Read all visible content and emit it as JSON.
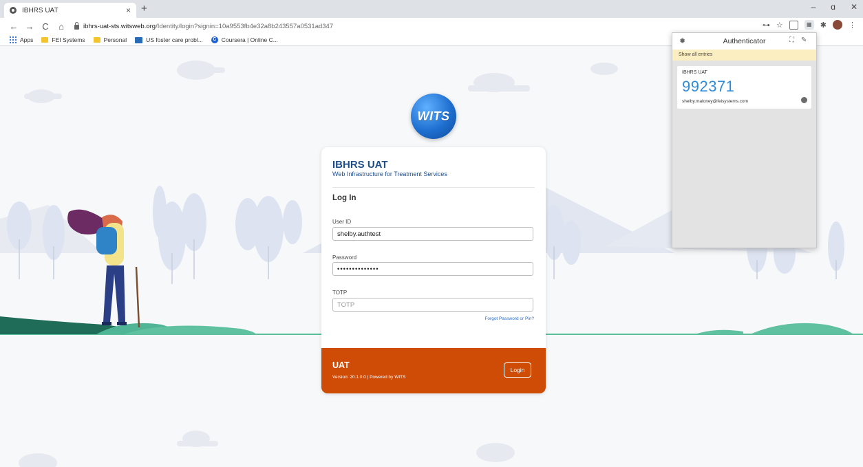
{
  "browser": {
    "tab_title": "IBHRS UAT",
    "tab_close": "×",
    "new_tab": "+",
    "window_controls": {
      "minimize": "–",
      "restore": "ɑ",
      "close": "✕"
    },
    "nav": {
      "back": "←",
      "forward": "→",
      "reload": "C",
      "home": "⌂"
    },
    "url_domain": "ibhrs-uat-sts.witsweb.org",
    "url_path": "/Identity/login?signin=10a9553fb4e32a8b243557a0531ad347",
    "toolbar": {
      "key": "⊶",
      "star": "☆",
      "menu": "⋮"
    },
    "bookmarks": [
      {
        "label": "Apps"
      },
      {
        "label": "FEI Systems"
      },
      {
        "label": "Personal"
      },
      {
        "label": "US foster care probl..."
      },
      {
        "label": "Coursera | Online C..."
      }
    ]
  },
  "page": {
    "logo_text": "WITS",
    "card": {
      "title": "IBHRS UAT",
      "subtitle": "Web Infrastructure for Treatment Services",
      "heading": "Log In",
      "user_id_label": "User ID",
      "user_id_value": "shelby.authtest",
      "password_label": "Password",
      "password_value": "••••••••••••••",
      "totp_label": "TOTP",
      "totp_placeholder": "TOTP",
      "forgot_link": "Forgot Password or Pin?",
      "footer_title": "UAT",
      "footer_version": "Version: 20.1.0.0 | Powered by WITS",
      "login_button": "Login"
    }
  },
  "authenticator": {
    "title": "Authenticator",
    "show_all": "Show all entries",
    "entries": [
      {
        "issuer": "IBHRS UAT",
        "code": "992371",
        "account": "shelby.maloney@feisystems.com"
      }
    ]
  },
  "colors": {
    "brand_blue": "#1e4d8c",
    "footer_orange": "#cf4c07",
    "code_blue": "#2f8ad7",
    "banner_yellow": "#fbeec0"
  }
}
